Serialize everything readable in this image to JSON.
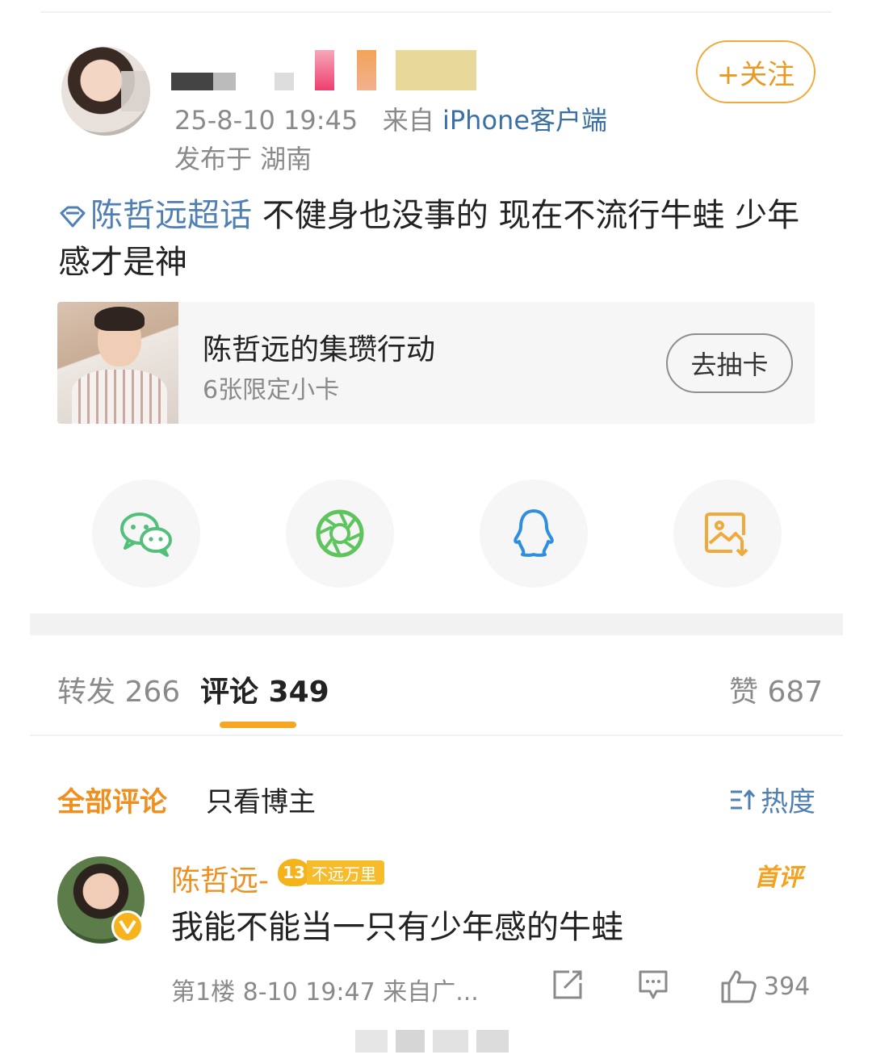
{
  "post": {
    "meta": {
      "time": "25-8-10 19:45",
      "source_prefix": "来自",
      "client": "iPhone客户端"
    },
    "location": "发布于 湖南",
    "follow_label": "+关注",
    "topic": "陈哲远超话",
    "text": "不健身也没事的 现在不流行牛蛙 少年感才是神"
  },
  "card": {
    "title": "陈哲远的集瓒行动",
    "subtitle": "6张限定小卡",
    "button": "去抽卡"
  },
  "share": [
    {
      "icon": "wechat-icon",
      "color": "#52c07a"
    },
    {
      "icon": "moments-icon",
      "color": "#5ec45e"
    },
    {
      "icon": "qq-icon",
      "color": "#2e8fe0"
    },
    {
      "icon": "save-image-icon",
      "color": "#f0a93b"
    }
  ],
  "tabs": {
    "repost": "转发 266",
    "comments": "评论 349",
    "likes": "赞 687"
  },
  "filters": {
    "all": "全部评论",
    "author_only": "只看博主",
    "sort": "热度"
  },
  "comment": {
    "name": "陈哲远-",
    "badge_level": "13",
    "badge_text": "不远万里",
    "first_tag": "首评",
    "text": "我能不能当一只有少年感的牛蛙",
    "meta": "第1楼 8-10 19:47 来自广...",
    "like_count": "394"
  }
}
